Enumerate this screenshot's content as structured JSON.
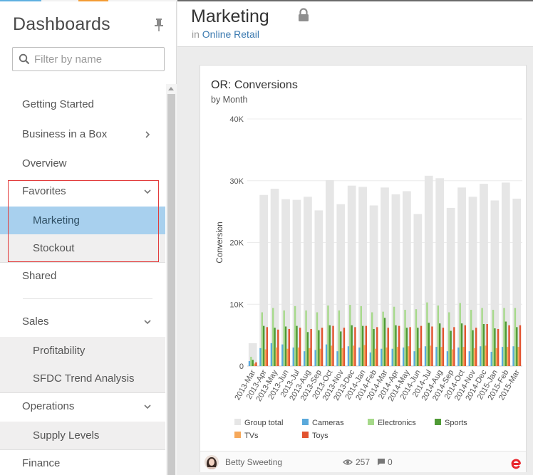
{
  "sidebar": {
    "title": "Dashboards",
    "filter_placeholder": "Filter by name",
    "items": [
      {
        "label": "Getting Started"
      },
      {
        "label": "Business in a Box"
      },
      {
        "label": "Overview"
      },
      {
        "label": "Favorites"
      },
      {
        "label": "Marketing"
      },
      {
        "label": "Stockout"
      },
      {
        "label": "Shared"
      },
      {
        "label": "Sales"
      },
      {
        "label": "Profitability"
      },
      {
        "label": "SFDC Trend Analysis"
      },
      {
        "label": "Operations"
      },
      {
        "label": "Supply Levels"
      },
      {
        "label": "Finance"
      }
    ]
  },
  "header": {
    "title": "Marketing",
    "breadcrumb_prefix": "in",
    "breadcrumb_link": "Online Retail"
  },
  "widget": {
    "title": "OR: Conversions",
    "subtitle": "by Month",
    "footer": {
      "author": "Betty Sweeting",
      "views": "257",
      "comments": "0"
    }
  },
  "colors": {
    "group_total": "#e6e6e6",
    "cameras": "#5aa9db",
    "electronics": "#a6d98a",
    "sports": "#4f9a35",
    "tvs": "#f6a85a",
    "toys": "#e2532f",
    "accent_active": "#a8d0ee",
    "highlight_border": "#e23b3b",
    "brand": "#e8262d"
  },
  "chart_data": {
    "type": "bar",
    "ylabel": "Conversion",
    "ylim": [
      0,
      40000
    ],
    "yticks": [
      "0",
      "10K",
      "20K",
      "30K",
      "40K"
    ],
    "categories": [
      "2013-Mar",
      "2013-Apr",
      "2013-May",
      "2013-Jun",
      "2013-Jul",
      "2013-Aug",
      "2013-Sep",
      "2013-Oct",
      "2013-Nov",
      "2013-Dec",
      "2014-Jan",
      "2014-Feb",
      "2014-Mar",
      "2014-Apr",
      "2014-May",
      "2014-Jun",
      "2014-Jul",
      "2014-Aug",
      "2014-Sep",
      "2014-Oct",
      "2014-Nov",
      "2014-Dec",
      "2015-Jan",
      "2015-Feb",
      "2015-Mar"
    ],
    "legend_position": "bottom",
    "series": [
      {
        "name": "Group total",
        "values": [
          3700,
          27700,
          28700,
          27000,
          26900,
          27400,
          25200,
          30100,
          26200,
          29200,
          29000,
          26000,
          28900,
          27800,
          28300,
          24600,
          30800,
          30400,
          25600,
          28900,
          27400,
          29500,
          26800,
          29700,
          27100
        ]
      },
      {
        "name": "Cameras",
        "values": [
          800,
          2900,
          3700,
          3500,
          3000,
          2400,
          2600,
          3500,
          2400,
          3200,
          3000,
          2200,
          2800,
          2800,
          3000,
          2400,
          3200,
          3100,
          2400,
          3000,
          2400,
          3200,
          2300,
          3100,
          3200
        ]
      },
      {
        "name": "Electronics",
        "values": [
          1500,
          8700,
          9400,
          9000,
          9700,
          9000,
          8700,
          9800,
          9000,
          9900,
          9700,
          8700,
          8800,
          9600,
          9100,
          9200,
          10300,
          9800,
          8700,
          10200,
          9100,
          9400,
          9100,
          9400,
          9400
        ]
      },
      {
        "name": "Sports",
        "values": [
          1000,
          6500,
          6200,
          6400,
          6500,
          5500,
          5800,
          6600,
          5600,
          6600,
          6500,
          6000,
          7800,
          6600,
          6200,
          6200,
          7000,
          6900,
          5700,
          6900,
          5800,
          6800,
          6100,
          7200,
          6300
        ]
      },
      {
        "name": "TVs",
        "values": [
          400,
          2700,
          3000,
          2800,
          3000,
          2900,
          2800,
          3300,
          2900,
          3300,
          3400,
          2800,
          3000,
          3100,
          3200,
          2900,
          3300,
          3100,
          2700,
          3100,
          2900,
          3300,
          2900,
          3100,
          3100
        ]
      },
      {
        "name": "Toys",
        "values": [
          600,
          6300,
          5900,
          6000,
          6200,
          6000,
          6200,
          6500,
          6200,
          6300,
          6500,
          6300,
          6200,
          6500,
          6300,
          6500,
          6400,
          6200,
          6300,
          6600,
          6200,
          6800,
          6000,
          6600,
          6600
        ]
      }
    ]
  }
}
